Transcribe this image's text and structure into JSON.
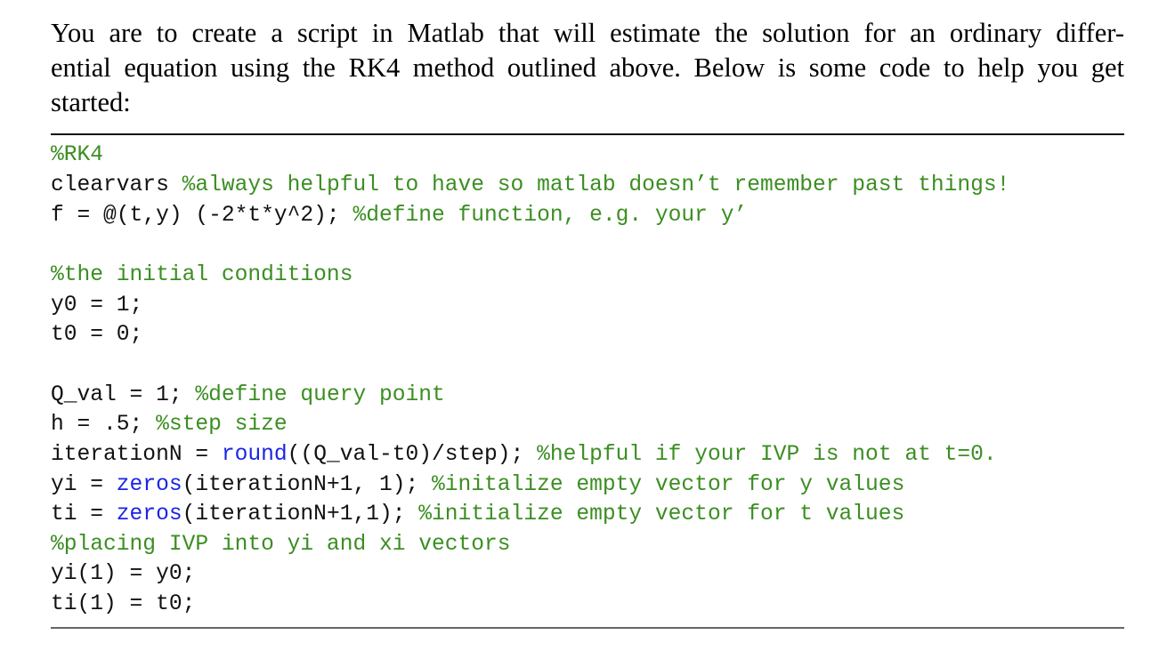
{
  "intro": {
    "lines": [
      "You are to create a script in Matlab that will estimate the solution for an ordinary differ-",
      "ential equation using the RK4 method outlined above. Below is some code to help you get",
      "started:"
    ]
  },
  "colors": {
    "comment": "#3b8e22",
    "keyword": "#1a25e6",
    "text": "#111111"
  },
  "code": {
    "lines": [
      {
        "code": "",
        "fn": "",
        "rest": "",
        "comment": "%RK4"
      },
      {
        "code": "clearvars ",
        "fn": "",
        "rest": "",
        "comment": "%always helpful to have so matlab doesn’t remember past things!"
      },
      {
        "code": "f = @(t,y) (-2*t*y^2); ",
        "fn": "",
        "rest": "",
        "comment": "%define function, e.g. your y’"
      },
      {
        "code": "",
        "fn": "",
        "rest": "",
        "comment": ""
      },
      {
        "code": "",
        "fn": "",
        "rest": "",
        "comment": "%the initial conditions"
      },
      {
        "code": "y0 = 1;",
        "fn": "",
        "rest": "",
        "comment": ""
      },
      {
        "code": "t0 = 0;",
        "fn": "",
        "rest": "",
        "comment": ""
      },
      {
        "code": "",
        "fn": "",
        "rest": "",
        "comment": ""
      },
      {
        "code": "Q_val = 1; ",
        "fn": "",
        "rest": "",
        "comment": "%define query point"
      },
      {
        "code": "h = .5; ",
        "fn": "",
        "rest": "",
        "comment": "%step size"
      },
      {
        "code": "iterationN = ",
        "fn": "round",
        "rest": "((Q_val-t0)/step); ",
        "comment": "%helpful if your IVP is not at t=0."
      },
      {
        "code": "yi = ",
        "fn": "zeros",
        "rest": "(iterationN+1, 1); ",
        "comment": "%initalize empty vector for y values"
      },
      {
        "code": "ti = ",
        "fn": "zeros",
        "rest": "(iterationN+1,1); ",
        "comment": "%initialize empty vector for t values"
      },
      {
        "code": "",
        "fn": "",
        "rest": "",
        "comment": "%placing IVP into yi and xi vectors"
      },
      {
        "code": "yi(1) = y0;",
        "fn": "",
        "rest": "",
        "comment": ""
      },
      {
        "code": "ti(1) = t0;",
        "fn": "",
        "rest": "",
        "comment": ""
      }
    ]
  }
}
